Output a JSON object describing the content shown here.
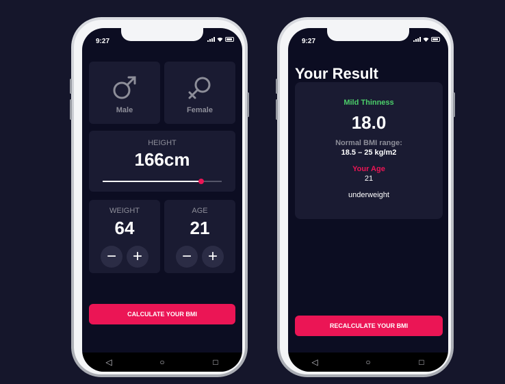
{
  "colors": {
    "background": "#15162b",
    "screen": "#0c0d22",
    "card": "#1a1b32",
    "accent": "#eb1555",
    "status_good": "#4ccf6a"
  },
  "phone1": {
    "status_time": "9:27",
    "gender": [
      {
        "label": "Male",
        "icon": "male-icon"
      },
      {
        "label": "Female",
        "icon": "female-icon"
      }
    ],
    "height": {
      "label": "HEIGHT",
      "value": "166cm",
      "slider_fraction": 0.83
    },
    "weight": {
      "label": "WEIGHT",
      "value": "64",
      "minus": "−",
      "plus": "+"
    },
    "age": {
      "label": "AGE",
      "value": "21",
      "minus": "−",
      "plus": "+"
    },
    "calculate_label": "CALCULATE YOUR BMI",
    "nav": {
      "back": "◁",
      "home": "○",
      "recent": "□"
    }
  },
  "phone2": {
    "status_time": "9:27",
    "title": "Your Result",
    "result": {
      "status": "Mild Thinness",
      "bmi": "18.0",
      "range_label": "Normal BMI range:",
      "range_value": "18.5 – 25 kg/m2",
      "age_label": "Your Age",
      "age_value": "21",
      "interpretation": "underweight"
    },
    "recalculate_label": "RECALCULATE YOUR BMI",
    "nav": {
      "back": "◁",
      "home": "○",
      "recent": "□"
    }
  }
}
